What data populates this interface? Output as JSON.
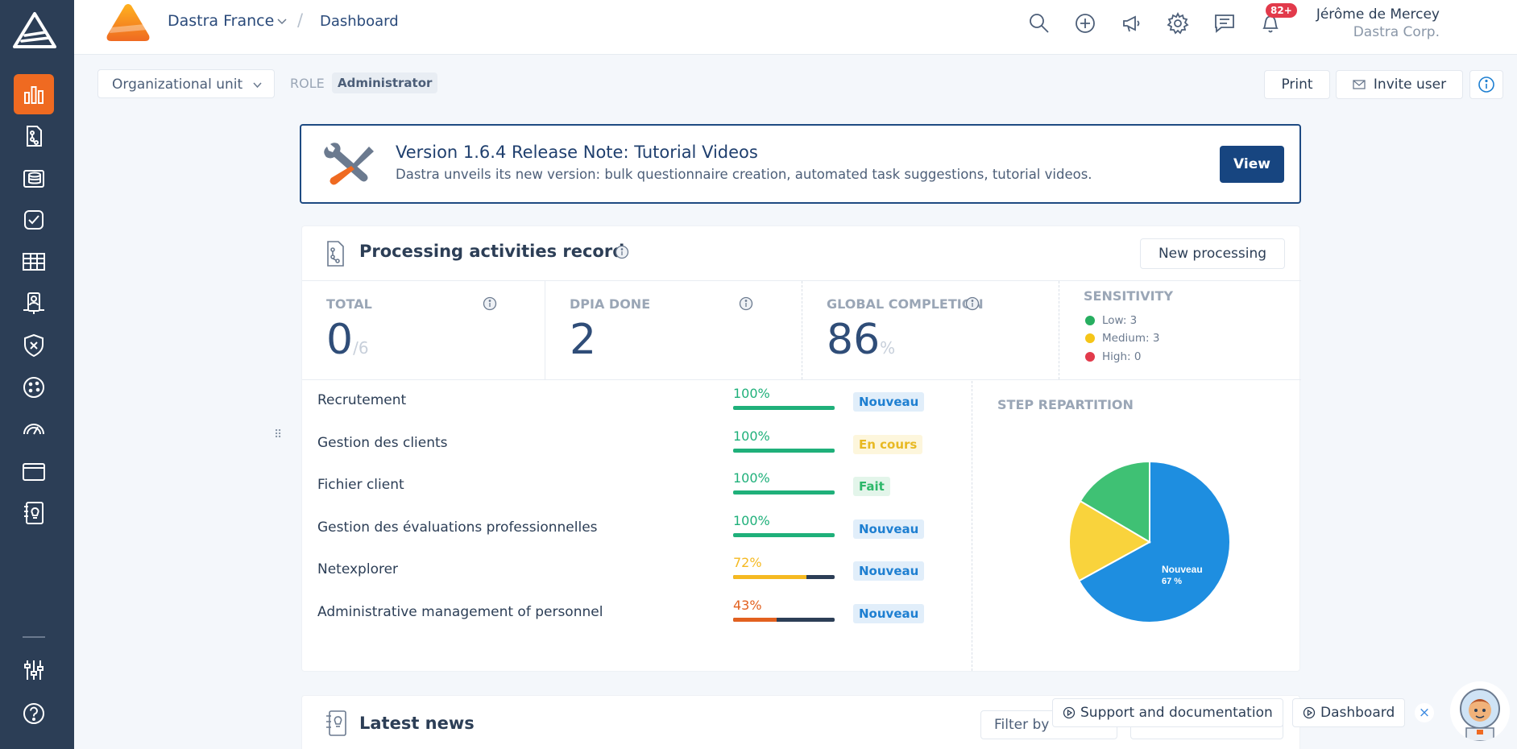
{
  "topbar": {
    "org_name": "Dastra France",
    "crumb_separator": "/",
    "page": "Dashboard",
    "notification_count": "82+",
    "user_name": "Jérôme de Mercey",
    "user_company": "Dastra Corp."
  },
  "toolbar": {
    "org_unit_label": "Organizational unit",
    "role_label": "ROLE",
    "role_value": "Administrator",
    "print_label": "Print",
    "invite_label": "Invite user"
  },
  "release": {
    "title": "Version 1.6.4 Release Note: Tutorial Videos",
    "description": "Dastra unveils its new version: bulk questionnaire creation, automated task suggestions, tutorial videos.",
    "view_label": "View"
  },
  "processing": {
    "title": "Processing activities record",
    "new_label": "New processing",
    "stats": {
      "total_label": "TOTAL",
      "total_value": "0",
      "total_sub": "/6",
      "dpia_label": "DPIA DONE",
      "dpia_value": "2",
      "completion_label": "GLOBAL COMPLETION",
      "completion_value": "86",
      "completion_unit": "%",
      "sensitivity_label": "SENSITIVITY",
      "sensitivity": [
        {
          "label": "Low: 3",
          "color": "#27ae60"
        },
        {
          "label": "Medium: 3",
          "color": "#f5c518"
        },
        {
          "label": "High: 0",
          "color": "#e23a4b"
        }
      ]
    },
    "rows": [
      {
        "name": "Recrutement",
        "pct_label": "100%",
        "pct": 100,
        "status": "Nouveau",
        "status_kind": "blue"
      },
      {
        "name": "Gestion des clients",
        "pct_label": "100%",
        "pct": 100,
        "status": "En cours",
        "status_kind": "yellow"
      },
      {
        "name": "Fichier client",
        "pct_label": "100%",
        "pct": 100,
        "status": "Fait",
        "status_kind": "green"
      },
      {
        "name": "Gestion des évaluations professionnelles",
        "pct_label": "100%",
        "pct": 100,
        "status": "Nouveau",
        "status_kind": "blue"
      },
      {
        "name": "Netexplorer",
        "pct_label": "72%",
        "pct": 72,
        "status": "Nouveau",
        "status_kind": "blue"
      },
      {
        "name": "Administrative management of personnel",
        "pct_label": "43%",
        "pct": 43,
        "status": "Nouveau",
        "status_kind": "blue"
      }
    ],
    "colors": {
      "done": "#1fb07a",
      "mid": "#f5b921",
      "low": "#e2611f"
    }
  },
  "step_repartition": {
    "label": "STEP REPARTITION",
    "slice_label": "Nouveau",
    "slice_pct": "67 %",
    "slices": [
      {
        "label": "Nouveau",
        "value": 67,
        "color": "#1e8ee0"
      },
      {
        "label": "En cours",
        "value": 16.5,
        "color": "#f9d33c"
      },
      {
        "label": "Fait",
        "value": 16.5,
        "color": "#3fc174"
      }
    ]
  },
  "news": {
    "title": "Latest news",
    "filter_label": "Filter by"
  },
  "help": {
    "support_label": "Support and documentation",
    "dashboard_label": "Dashboard",
    "close": "×"
  }
}
